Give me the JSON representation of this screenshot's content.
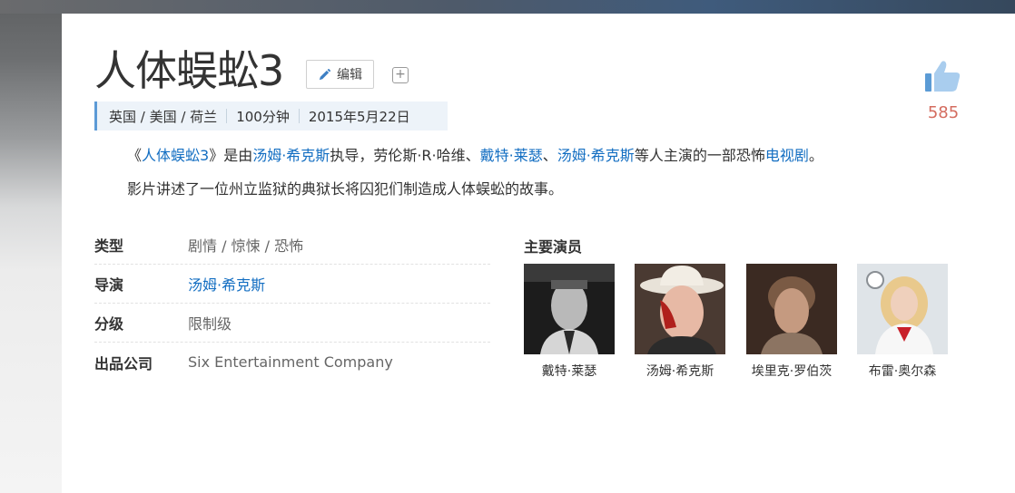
{
  "title": "人体蜈蚣3",
  "toolbar": {
    "edit_label": "编辑",
    "add_label": "+"
  },
  "meta": {
    "region": "英国 / 美国 / 荷兰",
    "duration": "100分钟",
    "release_date": "2015年5月22日"
  },
  "likes": {
    "count": "585",
    "icon": "thumbs-up-icon",
    "color": "#d46c5f"
  },
  "summary": {
    "p1": {
      "open_quote": "《",
      "title_link": "人体蜈蚣3",
      "close_quote": "》是由",
      "director_link": "汤姆·希克斯",
      "t1": "执导，劳伦斯·R·哈维、",
      "actor1_link": "戴特·莱瑟",
      "t2": "、",
      "actor2_link": "汤姆·希克斯",
      "t3": "等人主演的一部恐怖",
      "genre_link": "电视剧",
      "t4": "。"
    },
    "p2": "影片讲述了一位州立监狱的典狱长将囚犯们制造成人体蜈蚣的故事。"
  },
  "info": [
    {
      "label": "类型",
      "value": "剧情 / 惊悚 / 恐怖"
    },
    {
      "label": "导演",
      "value": "汤姆·希克斯"
    },
    {
      "label": "分级",
      "value": "限制级"
    },
    {
      "label": "出品公司",
      "value": "Six Entertainment Company"
    }
  ],
  "actors": {
    "title": "主要演员",
    "items": [
      {
        "name": "戴特·莱瑟"
      },
      {
        "name": "汤姆·希克斯"
      },
      {
        "name": "埃里克·罗伯茨"
      },
      {
        "name": "布雷·奥尔森"
      }
    ]
  },
  "colors": {
    "link": "#136ec2",
    "accent": "#5c9ad6",
    "meta_bg": "#edf3f9"
  }
}
